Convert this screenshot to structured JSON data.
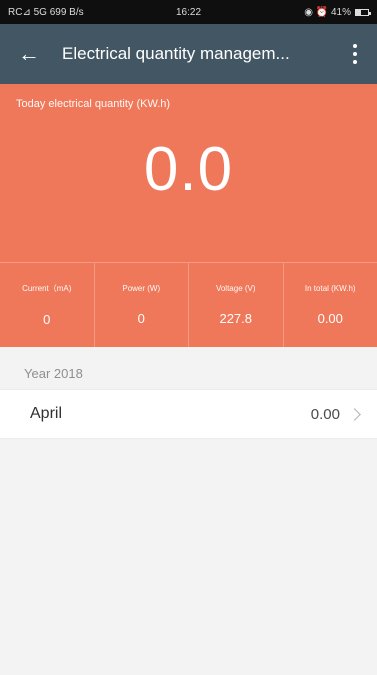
{
  "status_bar": {
    "left": "RC⊿ 5G 699 B/s",
    "time": "16:22",
    "right": "◉ ⏰ 41%"
  },
  "app_bar": {
    "title": "Electrical quantity managem..."
  },
  "hero": {
    "today_label": "Today electrical quantity (KW.h)",
    "today_value": "0.0",
    "metrics": [
      {
        "label": "Current（mA)",
        "value": "0"
      },
      {
        "label": "Power (W)",
        "value": "0"
      },
      {
        "label": "Voltage (V)",
        "value": "227.8"
      },
      {
        "label": "In total (KW.h)",
        "value": "0.00"
      }
    ]
  },
  "history": {
    "year_label": "Year 2018",
    "months": [
      {
        "name": "April",
        "value": "0.00"
      }
    ]
  },
  "icons": {
    "back": "arrow-left-icon",
    "more": "more-vertical-icon",
    "chevron": "chevron-right-icon"
  },
  "colors": {
    "app_bar": "#435663",
    "hero": "#f0785a",
    "background": "#f3f3f3",
    "status_bar": "#0f0f0f"
  }
}
